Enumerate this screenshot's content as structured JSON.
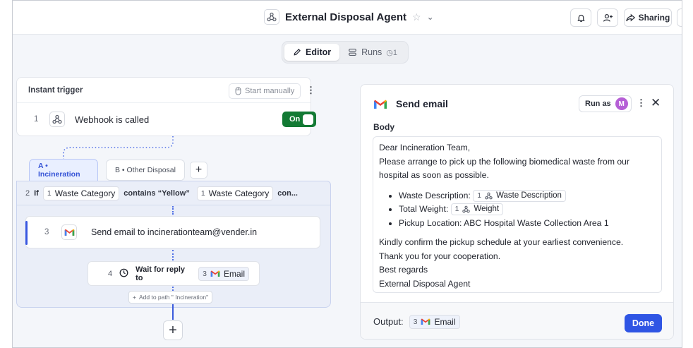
{
  "header": {
    "title": "External Disposal Agent",
    "sharing_label": "Sharing"
  },
  "view_tabs": {
    "editor_label": "Editor",
    "runs_label": "Runs",
    "runs_count": "1"
  },
  "trigger": {
    "section_label": "Instant trigger",
    "start_manually_label": "Start manually",
    "step_number": "1",
    "step_label": "Webhook is called",
    "toggle_label": "On"
  },
  "paths": {
    "tab_a": "A • Incineration",
    "tab_b": "B • Other Disposal"
  },
  "condition": {
    "number": "2",
    "if_label": "If",
    "chip1_num": "1",
    "chip1_label": "Waste Category",
    "operator": "contains “Yellow”",
    "chip2_num": "1",
    "chip2_label": "Waste Category",
    "more": "con..."
  },
  "step3": {
    "number": "3",
    "label": "Send email to incinerationteam@vender.in"
  },
  "step4": {
    "number": "4",
    "label": "Wait for reply to",
    "chip_num": "3",
    "chip_label": "Email"
  },
  "add_path_label": "Add to path \" Incineration\"",
  "panel": {
    "title": "Send email",
    "run_as_label": "Run as",
    "avatar_initial": "M",
    "body_label": "Body",
    "body": {
      "greeting": "Dear Incineration Team,",
      "intro": "Please arrange to pick up the following biomedical waste from our hospital as soon as possible.",
      "bullet1_label": "Waste Description:",
      "bullet1_chip_num": "1",
      "bullet1_chip_label": "Waste Description",
      "bullet2_label": "Total Weight:",
      "bullet2_chip_num": "1",
      "bullet2_chip_label": "Weight",
      "bullet3": "Pickup Location: ABC Hospital Waste Collection Area 1",
      "line1": "Kindly confirm the pickup schedule at your earliest convenience.",
      "line2": "Thank you for your cooperation.",
      "line3": "Best regards",
      "line4": "External Disposal Agent"
    },
    "output_label": "Output:",
    "output_chip_num": "3",
    "output_chip_label": "Email",
    "done_label": "Done"
  },
  "colors": {
    "accent": "#2f55e4",
    "toggle_on": "#137a34",
    "branch_bg": "#eaeef8",
    "avatar": "#b65fd6"
  }
}
